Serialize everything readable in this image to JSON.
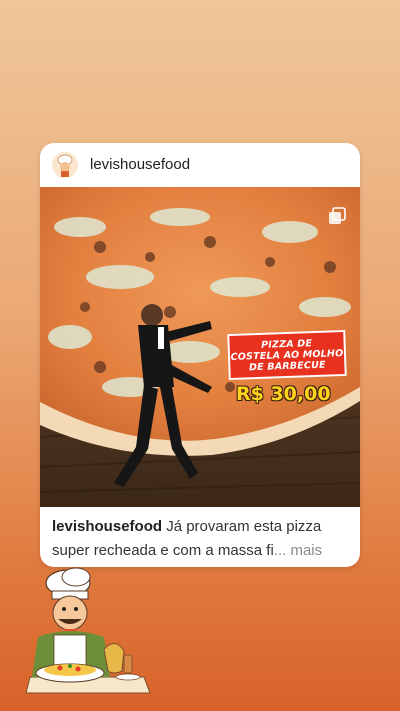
{
  "post": {
    "username": "levishousefood",
    "sign_text": "PIZZA DE\nCOSTELA AO MOLHO\nDE BARBECUE",
    "price": "R$ 30,00",
    "caption_user": "levishousefood",
    "caption_text": " Já provaram esta pizza super recheada e com a massa fi",
    "caption_ellipsis": "... mais"
  },
  "icons": {
    "avatar": "chef-avatar-icon",
    "multi": "multiple-images-icon",
    "sticker": "chef-eating-sticker"
  },
  "colors": {
    "background_top": "#efc79a",
    "background_bottom": "#d8622a",
    "sign_red": "#e8321f",
    "price_yellow": "#ffd21c"
  }
}
